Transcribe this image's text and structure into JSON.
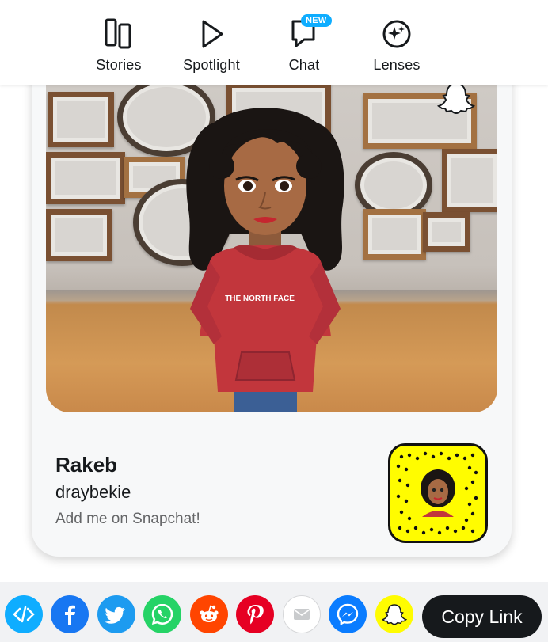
{
  "nav": {
    "items": [
      {
        "label": "Stories",
        "icon": "stories-icon"
      },
      {
        "label": "Spotlight",
        "icon": "spotlight-play-icon"
      },
      {
        "label": "Chat",
        "icon": "chat-icon"
      },
      {
        "label": "Lenses",
        "icon": "lenses-sparkle-icon"
      }
    ],
    "chat_badge": "NEW"
  },
  "profile": {
    "display_name": "Rakeb",
    "username": "draybekie",
    "cta": "Add me on Snapchat!",
    "hoodie_text": "THE NORTH FACE"
  },
  "share": {
    "buttons": [
      {
        "name": "embed",
        "icon": "embed-code-icon",
        "color": "#0fadff"
      },
      {
        "name": "facebook",
        "icon": "facebook-icon",
        "color": "#1877f2"
      },
      {
        "name": "twitter",
        "icon": "twitter-icon",
        "color": "#1d9bf0"
      },
      {
        "name": "whatsapp",
        "icon": "whatsapp-icon",
        "color": "#25d366"
      },
      {
        "name": "reddit",
        "icon": "reddit-icon",
        "color": "#ff4500"
      },
      {
        "name": "pinterest",
        "icon": "pinterest-icon",
        "color": "#e60023"
      },
      {
        "name": "email",
        "icon": "email-icon",
        "color": "#ffffff"
      },
      {
        "name": "messenger",
        "icon": "messenger-icon",
        "color": "#0a7cff"
      },
      {
        "name": "snapchat",
        "icon": "snapchat-ghost-icon",
        "color": "#fffc00"
      }
    ],
    "copy_link_label": "Copy Link"
  },
  "colors": {
    "snap_yellow": "#fffc00",
    "text_primary": "#16191c",
    "text_secondary": "#646567",
    "accent_blue": "#0fadff"
  }
}
